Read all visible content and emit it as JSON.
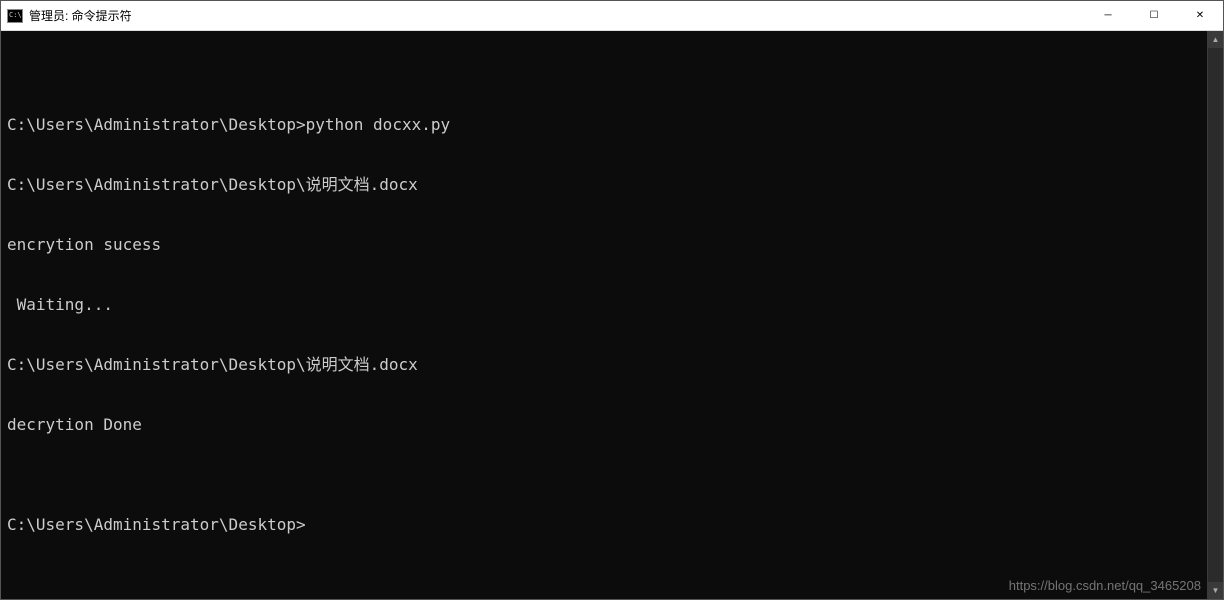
{
  "window": {
    "title": "管理员: 命令提示符",
    "icon_label": "C:\\"
  },
  "controls": {
    "minimize": "─",
    "maximize": "☐",
    "close": "✕"
  },
  "terminal": {
    "lines": [
      "",
      "C:\\Users\\Administrator\\Desktop>python docxx.py",
      "C:\\Users\\Administrator\\Desktop\\说明文档.docx",
      "encrytion sucess",
      " Waiting...",
      "C:\\Users\\Administrator\\Desktop\\说明文档.docx",
      "decrytion Done",
      "",
      "C:\\Users\\Administrator\\Desktop>"
    ]
  },
  "scrollbar": {
    "up": "▲",
    "down": "▼"
  },
  "watermark": "https://blog.csdn.net/qq_3465208"
}
